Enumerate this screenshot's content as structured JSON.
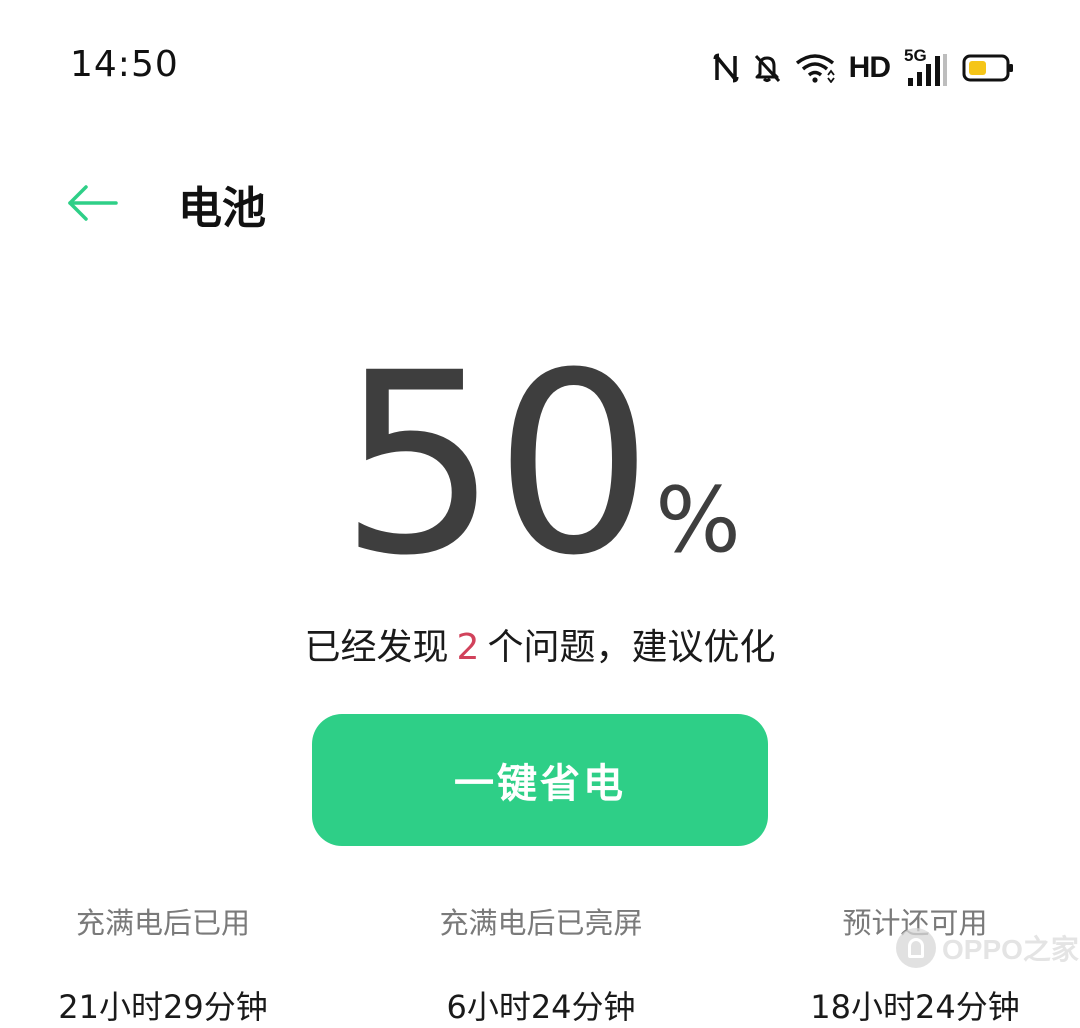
{
  "status_bar": {
    "time": "14:50",
    "network_label": "HD",
    "signal_label": "5G",
    "battery_color": "#f5c518"
  },
  "header": {
    "back_icon": "arrow-left-icon",
    "title": "电池",
    "accent_color": "#2ecf87"
  },
  "battery": {
    "level": "50",
    "unit": "%"
  },
  "issues": {
    "prefix": "已经发现",
    "count": "2",
    "suffix": "个问题，建议优化"
  },
  "optimize_button": {
    "label": "一键省电"
  },
  "stats": [
    {
      "label": "充满电后已用",
      "value": "21小时29分钟"
    },
    {
      "label": "充满电后已亮屏",
      "value": "6小时24分钟"
    },
    {
      "label": "预计还可用",
      "value": "18小时24分钟"
    }
  ],
  "watermark": {
    "text": "OPPO之家"
  }
}
